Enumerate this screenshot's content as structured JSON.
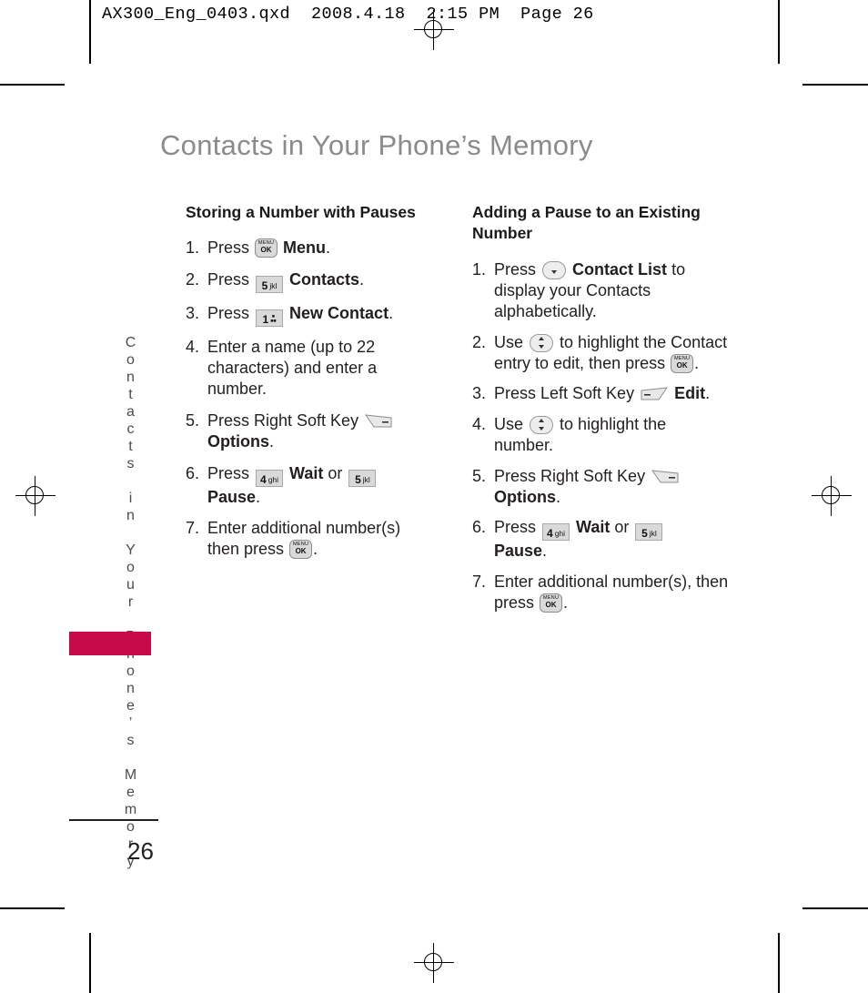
{
  "slug": "AX300_Eng_0403.qxd  2008.4.18  2:15 PM  Page 26",
  "page_title": "Contacts in Your Phone’s Memory",
  "side_tab": "Contacts in Your Phone’s Memory",
  "folio": "26",
  "colors": {
    "accent_bar": "#c80a4b",
    "title_gray": "#8b8b8b",
    "body_text": "#231f20",
    "key_fill": "#d9d9d9"
  },
  "left_column": {
    "heading": "Storing a Number with Pauses",
    "steps": [
      {
        "num": "1.",
        "pre": "Press",
        "key": "menu-ok",
        "bold": "Menu",
        "post": "."
      },
      {
        "num": "2.",
        "pre": "Press",
        "key": "key-5-jkl",
        "key_digit": "5",
        "key_sub": "jkl",
        "bold": "Contacts",
        "post": "."
      },
      {
        "num": "3.",
        "pre": "Press",
        "key": "key-1-abc",
        "key_digit": "1",
        "key_sub": "⌂",
        "bold": "New Contact",
        "post": "."
      },
      {
        "num": "4.",
        "text": "Enter a name (up to 22 characters) and enter a number."
      },
      {
        "num": "5.",
        "pre": "Press Right Soft Key",
        "key": "right-soft-key",
        "bold": "Options",
        "post": "."
      },
      {
        "num": "6.",
        "pre": "Press",
        "key": "key-4-ghi",
        "key_digit": "4",
        "key_sub": "ghi",
        "bold": "Wait",
        "mid": "or",
        "key2_digit": "5",
        "key2_sub": "jkl",
        "bold2": "Pause",
        "post": "."
      },
      {
        "num": "7.",
        "pre": "Enter additional number(s) then press",
        "key": "menu-ok",
        "post": "."
      }
    ]
  },
  "right_column": {
    "heading": "Adding a Pause to an Existing Number",
    "steps": [
      {
        "num": "1.",
        "pre": "Press",
        "key": "nav-down-key",
        "bold": "Contact List",
        "post": " to display your Contacts alphabetically."
      },
      {
        "num": "2.",
        "pre": "Use",
        "key": "nav-updown-key",
        "post": " to highlight the Contact entry to edit, then press",
        "key2": "menu-ok",
        "post2": "."
      },
      {
        "num": "3.",
        "pre": "Press Left Soft Key",
        "key": "left-soft-key",
        "bold": "Edit",
        "post": "."
      },
      {
        "num": "4.",
        "pre": "Use",
        "key": "nav-updown-key",
        "post": " to highlight the number."
      },
      {
        "num": "5.",
        "pre": "Press Right Soft Key",
        "key": "right-soft-key",
        "bold": "Options",
        "post": "."
      },
      {
        "num": "6.",
        "pre": "Press",
        "key_digit": "4",
        "key_sub": "ghi",
        "bold": "Wait",
        "mid": "or",
        "key2_digit": "5",
        "key2_sub": "jkl",
        "bold2": "Pause",
        "post": "."
      },
      {
        "num": "7.",
        "pre": "Enter additional number(s), then press",
        "key": "menu-ok",
        "post": "."
      }
    ]
  }
}
